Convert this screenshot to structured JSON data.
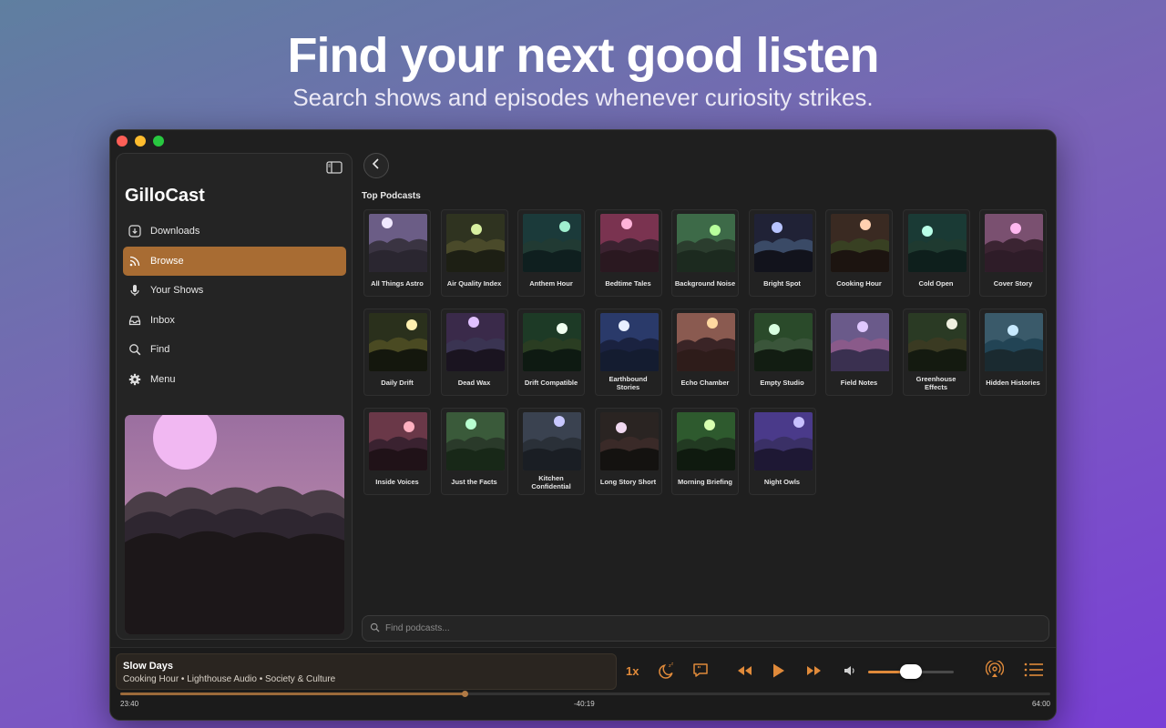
{
  "hero": {
    "title": "Find your next good listen",
    "subtitle": "Search shows and episodes whenever curiosity strikes."
  },
  "sidebar": {
    "app_name": "GilloCast",
    "items": [
      {
        "label": "Downloads",
        "icon": "download-icon",
        "active": false
      },
      {
        "label": "Browse",
        "icon": "rss-icon",
        "active": true
      },
      {
        "label": "Your Shows",
        "icon": "microphone-icon",
        "active": false
      },
      {
        "label": "Inbox",
        "icon": "inbox-icon",
        "active": false
      },
      {
        "label": "Find",
        "icon": "search-icon",
        "active": false
      },
      {
        "label": "Menu",
        "icon": "gear-icon",
        "active": false
      }
    ]
  },
  "main": {
    "section_title": "Top Podcasts",
    "search_placeholder": "Find podcasts...",
    "podcasts": [
      "All Things Astro",
      "Air Quality Index",
      "Anthem Hour",
      "Bedtime Tales",
      "Background Noise",
      "Bright Spot",
      "Cooking Hour",
      "Cold Open",
      "Cover Story",
      "Daily Drift",
      "Dead Wax",
      "Drift Compatible",
      "Earthbound Stories",
      "Echo Chamber",
      "Empty Studio",
      "Field Notes",
      "Greenhouse Effects",
      "Hidden Histories",
      "Inside Voices",
      "Just the Facts",
      "Kitchen Confidential",
      "Long Story Short",
      "Morning Briefing",
      "Night Owls"
    ]
  },
  "player": {
    "title": "Slow Days",
    "meta": "Cooking Hour • Lighthouse Audio • Society & Culture",
    "elapsed": "23:40",
    "remaining": "-40:19",
    "total": "64:00",
    "progress_fraction": 0.37,
    "speed": "1x",
    "volume_fraction": 0.5
  },
  "colors": {
    "accent": "#e08a3a",
    "active_nav": "#a86c33"
  }
}
